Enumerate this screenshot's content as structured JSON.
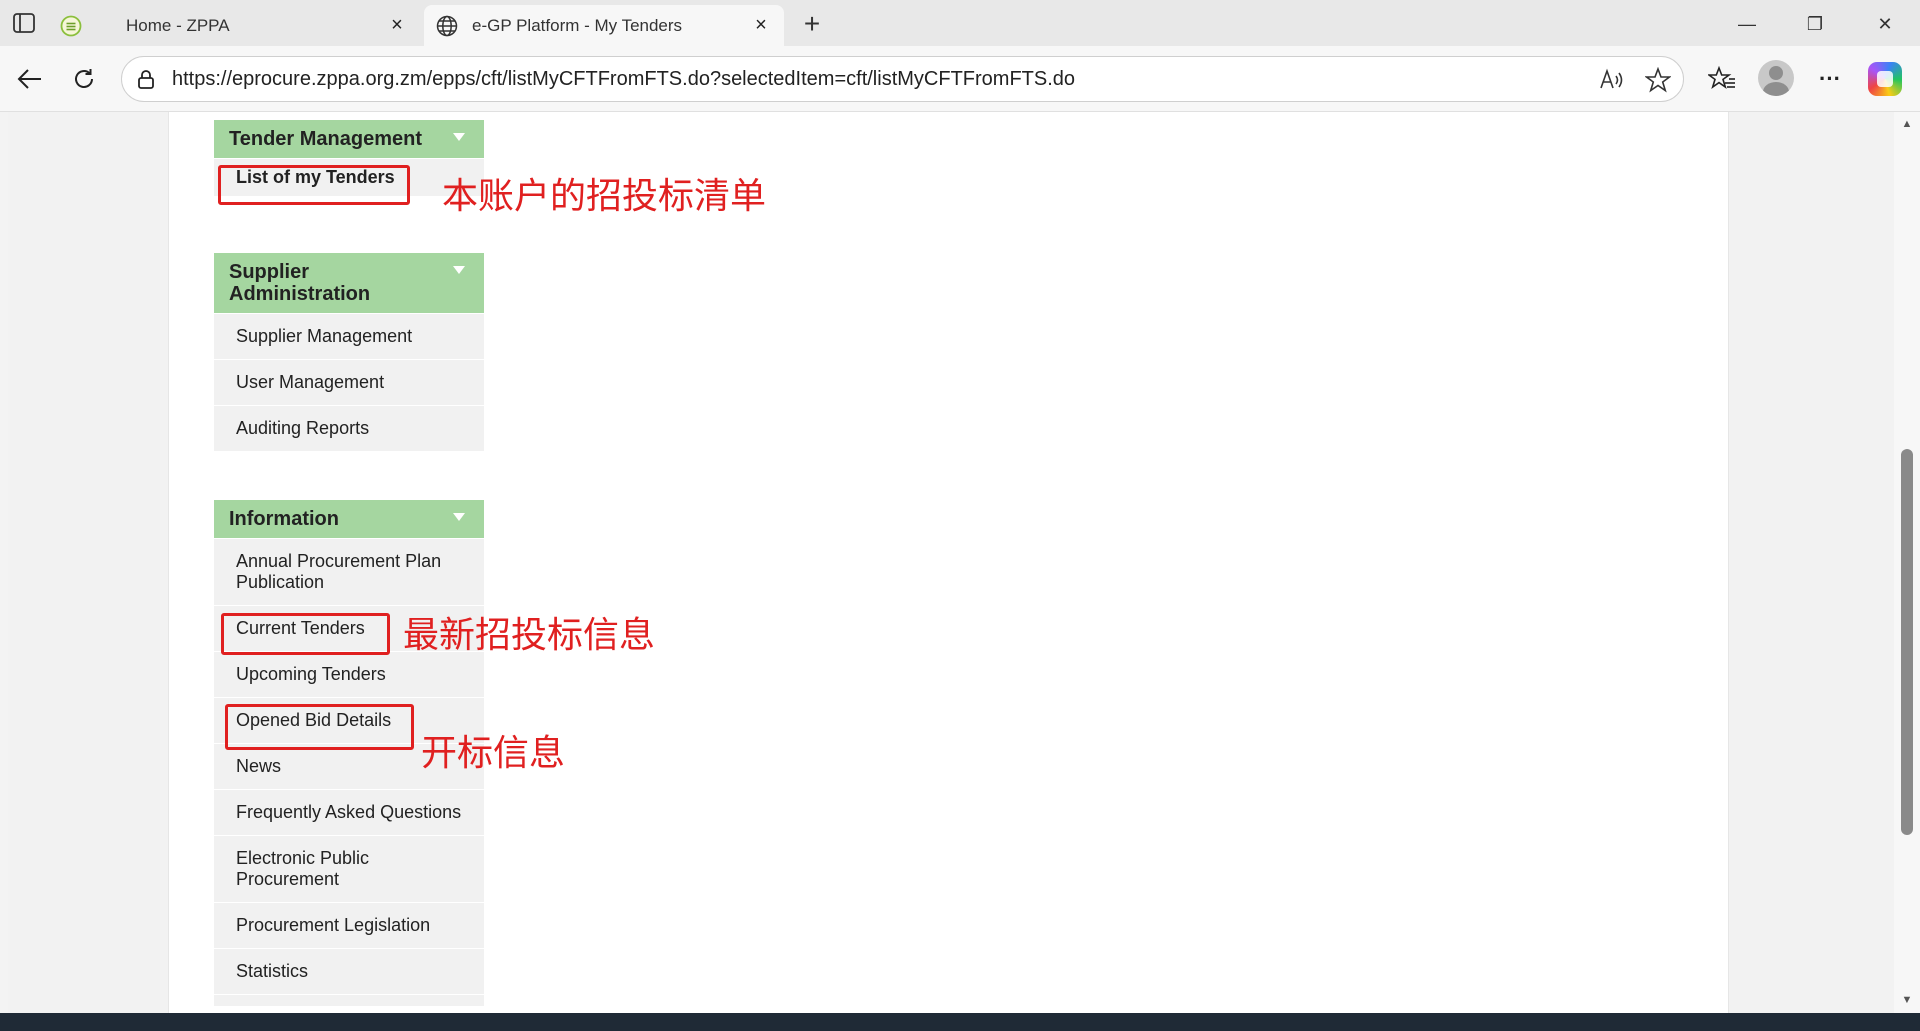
{
  "browser": {
    "tabs": [
      {
        "title": "Home - ZPPA",
        "close": "×"
      },
      {
        "title": "e-GP Platform - My Tenders",
        "close": "×"
      }
    ],
    "new_tab": "+",
    "window_controls": {
      "minimize": "—",
      "restore": "❐",
      "close": "✕"
    },
    "address_bar": {
      "url": "https://eprocure.zppa.org.zm/epps/cft/listMyCFTFromFTS.do?selectedItem=cft/listMyCFTFromFTS.do"
    },
    "more_menu": "···"
  },
  "sidebar": {
    "tender_management": {
      "header": "Tender Management",
      "items": [
        "List of my Tenders"
      ]
    },
    "supplier_administration": {
      "header_line1": "Supplier",
      "header_line2": "Administration",
      "items": [
        "Supplier Management",
        "User Management",
        "Auditing Reports"
      ]
    },
    "information": {
      "header": "Information",
      "items": [
        {
          "line1": "Annual Procurement Plan",
          "line2": "Publication"
        },
        {
          "line1": "Current Tenders"
        },
        {
          "line1": "Upcoming Tenders"
        },
        {
          "line1": "Opened Bid Details"
        },
        {
          "line1": "News"
        },
        {
          "line1": "Frequently Asked Questions"
        },
        {
          "line1": "Electronic Public",
          "line2": "Procurement"
        },
        {
          "line1": "Procurement Legislation"
        },
        {
          "line1": "Statistics"
        }
      ]
    }
  },
  "annotations": {
    "my_tenders": "本账户的招投标清单",
    "current_tenders": "最新招投标信息",
    "opened_bids": "开标信息"
  },
  "colors": {
    "menu_header_bg": "#a5d6a0",
    "menu_item_bg": "#f1f1f1",
    "annotation_red": "#e02020"
  }
}
